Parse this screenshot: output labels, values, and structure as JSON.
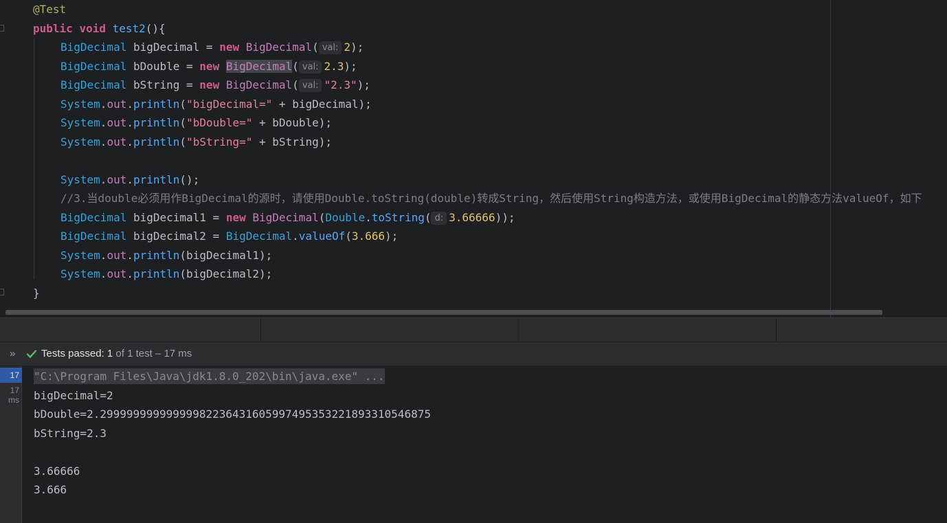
{
  "editor": {
    "annotation": "@Test",
    "method_kw_public": "public",
    "method_kw_void": "void",
    "method_name": "test2",
    "method_sig_rest": "(){",
    "type_bigdecimal": "BigDecimal",
    "type_system": "System",
    "kw_new": "new",
    "hint_val": "val:",
    "hint_d": "d:",
    "var_bigDecimal": " bigDecimal = ",
    "var_bDouble": " bDouble = ",
    "var_bString": " bString = ",
    "arg_2": "2",
    "arg_2_3": "2.3",
    "arg_str_2_3": "\"2.3\"",
    "close_paren_semi": ");",
    "open_paren": "(",
    "dot": ".",
    "field_out": "out",
    "method_println": "println",
    "str_bigDecimal_eq": "\"bigDecimal=\"",
    "str_bDouble_eq": "\"bDouble=\"",
    "str_bString_eq": "\"bString=\"",
    "concat_bigDecimal": " + bigDecimal);",
    "concat_bDouble": " + bDouble);",
    "concat_bString": " + bString);",
    "println_empty": "();",
    "comment": "//3.当double必须用作BigDecimal的源时，请使用Double.toString(double)转成String，然后使用String构造方法，或使用BigDecimal的静态方法valueOf，如下",
    "var_bigDecimal1": " bigDecimal1 = ",
    "var_bigDecimal2": " bigDecimal2 = ",
    "type_double": "Double",
    "method_toString": "toString",
    "arg_3_66666": "3.66666",
    "close_double_paren_semi": "));",
    "method_valueOf": "valueOf",
    "arg_3_666": "3.666",
    "print_bigDecimal1": "(bigDecimal1);",
    "print_bigDecimal2": "(bigDecimal2);",
    "close_brace": "}"
  },
  "test_bar": {
    "chevron": "»",
    "passed_label": "Tests passed: 1",
    "passed_rest": " of 1 test – 17 ms"
  },
  "sidebar": {
    "duration_selected": "17 ms",
    "duration_child": "17 ms"
  },
  "console": {
    "lines": [
      "\"C:\\Program Files\\Java\\jdk1.8.0_202\\bin\\java.exe\" ...",
      "bigDecimal=2",
      "bDouble=2.29999999999999982236431605997495353221893310546875",
      "bString=2.3",
      "",
      "3.66666",
      "3.666"
    ]
  }
}
